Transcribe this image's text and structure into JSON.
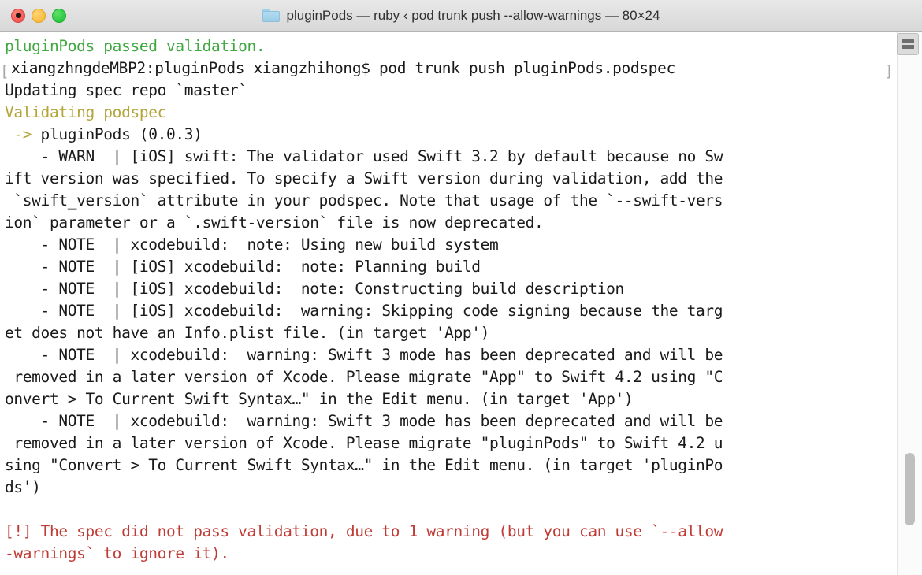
{
  "window": {
    "title": "pluginPods — ruby ‹ pod trunk push --allow-warnings — 80×24",
    "folder_icon": "folder-icon",
    "controls": {
      "close": "close-button",
      "minimize": "minimize-button",
      "zoom": "zoom-button"
    },
    "split_pane_icon": "split-pane-icon"
  },
  "terminal": {
    "prompt_bracket_left": "[",
    "prompt_bracket_right": "]",
    "lines": [
      {
        "text": "pluginPods passed validation.",
        "color": "green"
      },
      {
        "text": "xiangzhngdeMBP2:pluginPods xiangzhihong$ pod trunk push pluginPods.podspec",
        "color": "black",
        "indent": 1
      },
      {
        "text": "Updating spec repo `master`",
        "color": "black"
      },
      {
        "text": "Validating podspec",
        "color": "yellow"
      },
      {
        "text": " -> pluginPods (0.0.3)",
        "color": "yellow-arrow"
      },
      {
        "text": "    - WARN  | [iOS] swift: The validator used Swift 3.2 by default because no Sw",
        "color": "black"
      },
      {
        "text": "ift version was specified. To specify a Swift version during validation, add the",
        "color": "black"
      },
      {
        "text": " `swift_version` attribute in your podspec. Note that usage of the `--swift-vers",
        "color": "black"
      },
      {
        "text": "ion` parameter or a `.swift-version` file is now deprecated.",
        "color": "black"
      },
      {
        "text": "    - NOTE  | xcodebuild:  note: Using new build system",
        "color": "black"
      },
      {
        "text": "    - NOTE  | [iOS] xcodebuild:  note: Planning build",
        "color": "black"
      },
      {
        "text": "    - NOTE  | [iOS] xcodebuild:  note: Constructing build description",
        "color": "black"
      },
      {
        "text": "    - NOTE  | [iOS] xcodebuild:  warning: Skipping code signing because the targ",
        "color": "black"
      },
      {
        "text": "et does not have an Info.plist file. (in target 'App')",
        "color": "black"
      },
      {
        "text": "    - NOTE  | xcodebuild:  warning: Swift 3 mode has been deprecated and will be",
        "color": "black"
      },
      {
        "text": " removed in a later version of Xcode. Please migrate \"App\" to Swift 4.2 using \"C",
        "color": "black"
      },
      {
        "text": "onvert > To Current Swift Syntax…\" in the Edit menu. (in target 'App')",
        "color": "black"
      },
      {
        "text": "    - NOTE  | xcodebuild:  warning: Swift 3 mode has been deprecated and will be",
        "color": "black"
      },
      {
        "text": " removed in a later version of Xcode. Please migrate \"pluginPods\" to Swift 4.2 u",
        "color": "black"
      },
      {
        "text": "sing \"Convert > To Current Swift Syntax…\" in the Edit menu. (in target 'pluginPo",
        "color": "black"
      },
      {
        "text": "ds')",
        "color": "black"
      },
      {
        "text": "",
        "color": "black"
      },
      {
        "text": "[!] The spec did not pass validation, due to 1 warning (but you can use `--allow",
        "color": "red"
      },
      {
        "text": "-warnings` to ignore it).",
        "color": "red"
      }
    ]
  },
  "colors": {
    "green": "#3fa93f",
    "yellow": "#b3a53a",
    "red": "#c03b35",
    "black": "#1a1a1a",
    "gray": "#a8a8a8",
    "background": "#ffffff",
    "titlebar": "#e0e0e0"
  },
  "scrollbar": {
    "name": "vertical-scrollbar"
  }
}
